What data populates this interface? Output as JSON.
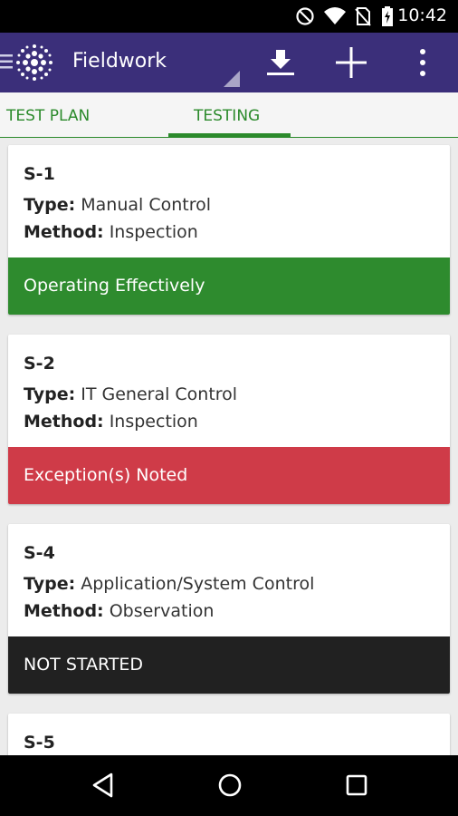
{
  "status_bar": {
    "time": "10:42",
    "icons": [
      "do-not-disturb-icon",
      "wifi-icon",
      "no-sim-icon",
      "battery-charging-icon"
    ]
  },
  "app_bar": {
    "title": "Fieldwork",
    "icons": [
      "drawer-menu-icon",
      "app-logo-icon",
      "download-icon",
      "add-icon",
      "overflow-menu-icon"
    ]
  },
  "tabs": [
    {
      "label": "TEST PLAN",
      "selected": false
    },
    {
      "label": "TESTING",
      "selected": true
    }
  ],
  "cards": [
    {
      "id": "S-1",
      "type_label": "Type:",
      "type": "Manual Control",
      "method_label": "Method:",
      "method": "Inspection",
      "status": "Operating Effectively",
      "status_color": "#2e8b2e"
    },
    {
      "id": "S-2",
      "type_label": "Type:",
      "type": "IT General Control",
      "method_label": "Method:",
      "method": "Inspection",
      "status": "Exception(s) Noted",
      "status_color": "#cf3b48"
    },
    {
      "id": "S-4",
      "type_label": "Type:",
      "type": "Application/System Control",
      "method_label": "Method:",
      "method": "Observation",
      "status": "NOT STARTED",
      "status_color": "#212121"
    },
    {
      "id": "S-5"
    }
  ],
  "colors": {
    "app_bar": "#3b2f7a",
    "accent": "#2b8a2b"
  },
  "nav_bar": {
    "icons": [
      "back-icon",
      "home-icon",
      "recents-icon"
    ]
  }
}
